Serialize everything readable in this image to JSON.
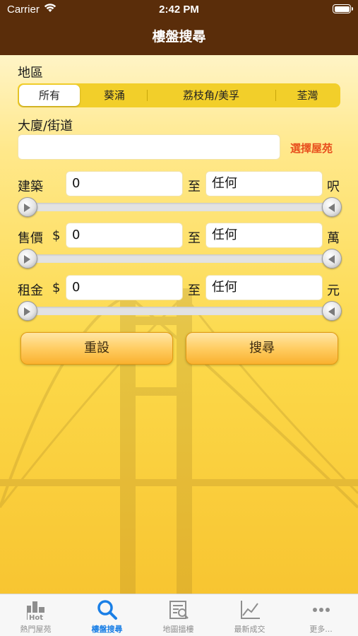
{
  "status_bar": {
    "carrier": "Carrier",
    "time": "2:42 PM"
  },
  "nav": {
    "title": "樓盤搜尋"
  },
  "form": {
    "district_label": "地區",
    "districts": [
      "所有",
      "葵涌",
      "荔枝角/美孚",
      "荃灣"
    ],
    "selected_district": "所有",
    "building_label": "大廈/街道",
    "building_value": "",
    "building_placeholder": "",
    "pick_estate": "選擇屋苑",
    "to_label": "至",
    "area": {
      "label": "建築",
      "prefix": "",
      "min": "0",
      "max": "任何",
      "unit": "呎"
    },
    "price": {
      "label": "售價",
      "prefix": "$",
      "min": "0",
      "max": "任何",
      "unit": "萬"
    },
    "rent": {
      "label": "租金",
      "prefix": "$",
      "min": "0",
      "max": "任何",
      "unit": "元"
    },
    "reset_label": "重設",
    "search_label": "搜尋"
  },
  "tabs": [
    {
      "label": "熱門屋苑",
      "icon": "hot-buildings-icon"
    },
    {
      "label": "樓盤搜尋",
      "icon": "search-icon"
    },
    {
      "label": "地圖搵樓",
      "icon": "map-search-icon"
    },
    {
      "label": "最新成交",
      "icon": "chart-icon"
    },
    {
      "label": "更多...",
      "icon": "more-icon"
    }
  ],
  "colors": {
    "nav": "#5a2d0a",
    "accent": "#1a7fe6",
    "link": "#e8501e",
    "background": "#fcd94a"
  }
}
